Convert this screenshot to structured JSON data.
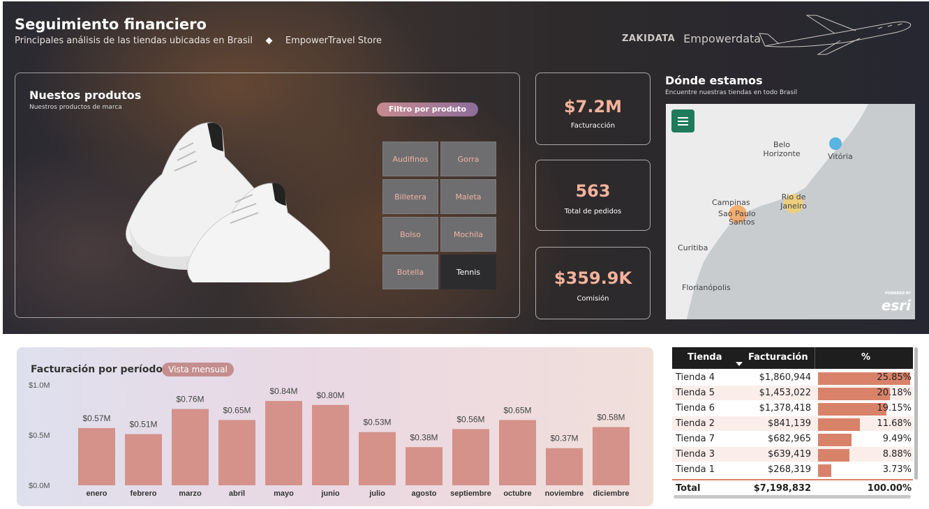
{
  "header": {
    "title": "Seguimiento financiero",
    "subtitle": "Principales análisis de las tiendas ubicadas en Brasil",
    "store": "EmpowerTravel Store",
    "brand_a": "ZAKIDATA",
    "brand_b": "Empowerdata"
  },
  "products": {
    "title": "Nuestos produtos",
    "subtitle": "Nuestros productos de marca",
    "filter_label": "Filtro por produto",
    "items": [
      "Audifinos",
      "Gorra",
      "Billetera",
      "Maleta",
      "Bolso",
      "Mochila",
      "Botella",
      "Tennis"
    ],
    "selected": "Tennis"
  },
  "kpis": [
    {
      "value": "$7.2M",
      "label": "Facturacción"
    },
    {
      "value": "563",
      "label": "Total de pedidos"
    },
    {
      "value": "$359.9K",
      "label": "Comisión"
    }
  ],
  "map": {
    "title": "Dónde estamos",
    "subtitle": "Encuentre nuestras tiendas en todo Brasil",
    "cities": [
      "Belo Horizonte",
      "Vitória",
      "Campinas",
      "Sao Paulo",
      "Santos",
      "Rio de Janeiro",
      "Curitiba",
      "Florianópolis"
    ],
    "logo": "esri",
    "logo_small": "POWERED BY"
  },
  "chart": {
    "title": "Facturación por período",
    "toggle": "Vista mensual"
  },
  "chart_data": {
    "type": "bar",
    "categories": [
      "enero",
      "febrero",
      "marzo",
      "abril",
      "mayo",
      "junio",
      "julio",
      "agosto",
      "septiembre",
      "octubre",
      "noviembre",
      "diciembre"
    ],
    "values": [
      0.57,
      0.51,
      0.76,
      0.65,
      0.84,
      0.8,
      0.53,
      0.38,
      0.56,
      0.65,
      0.37,
      0.58
    ],
    "value_labels": [
      "$0.57M",
      "$0.51M",
      "$0.76M",
      "$0.65M",
      "$0.84M",
      "$0.80M",
      "$0.53M",
      "$0.38M",
      "$0.56M",
      "$0.65M",
      "$0.37M",
      "$0.58M"
    ],
    "y_ticks": [
      "$0.0M",
      "$0.5M",
      "$1.0M"
    ],
    "ylim": [
      0,
      1.0
    ],
    "bar_color": "#d4928a"
  },
  "table": {
    "headers": [
      "Tienda",
      "Facturación",
      "%"
    ],
    "rows": [
      {
        "store": "Tienda 4",
        "revenue": "$1,860,944",
        "pct": "25.85%",
        "share": 25.85
      },
      {
        "store": "Tienda 5",
        "revenue": "$1,453,022",
        "pct": "20.18%",
        "share": 20.18
      },
      {
        "store": "Tienda 6",
        "revenue": "$1,378,418",
        "pct": "19.15%",
        "share": 19.15
      },
      {
        "store": "Tienda 2",
        "revenue": "$841,139",
        "pct": "11.68%",
        "share": 11.68
      },
      {
        "store": "Tienda 7",
        "revenue": "$682,965",
        "pct": "9.49%",
        "share": 9.49
      },
      {
        "store": "Tienda 3",
        "revenue": "$639,419",
        "pct": "8.88%",
        "share": 8.88
      },
      {
        "store": "Tienda 1",
        "revenue": "$268,319",
        "pct": "3.73%",
        "share": 3.73
      }
    ],
    "total": {
      "label": "Total",
      "revenue": "$7,198,832",
      "pct": "100.00%"
    }
  }
}
